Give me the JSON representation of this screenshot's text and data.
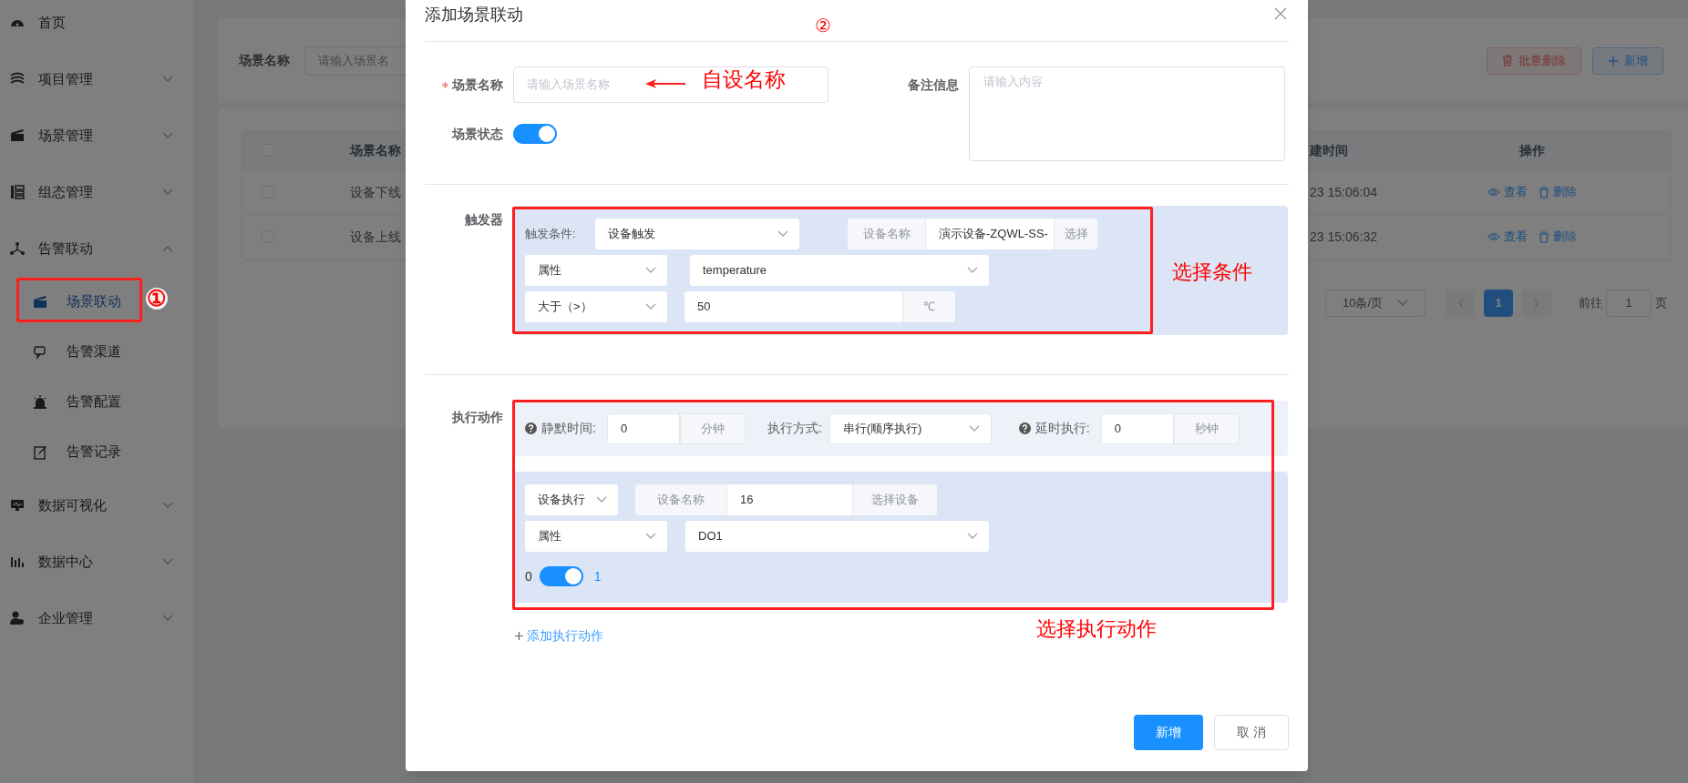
{
  "sidebar": {
    "items": [
      {
        "label": "首页",
        "expandable": false
      },
      {
        "label": "项目管理",
        "expandable": true,
        "expanded": false
      },
      {
        "label": "场景管理",
        "expandable": true,
        "expanded": false
      },
      {
        "label": "组态管理",
        "expandable": true,
        "expanded": false
      },
      {
        "label": "告警联动",
        "expandable": true,
        "expanded": true,
        "children": [
          {
            "label": "场景联动",
            "selected": true
          },
          {
            "label": "告警渠道",
            "selected": false
          },
          {
            "label": "告警配置",
            "selected": false
          },
          {
            "label": "告警记录",
            "selected": false
          }
        ]
      },
      {
        "label": "数据可视化",
        "expandable": true,
        "expanded": false
      },
      {
        "label": "数据中心",
        "expandable": true,
        "expanded": false
      },
      {
        "label": "企业管理",
        "expandable": true,
        "expanded": false
      }
    ]
  },
  "page": {
    "search": {
      "label": "场景名称",
      "placeholder": "请输入场景名"
    },
    "buttons": [
      {
        "label": "批量删除",
        "kind": "danger"
      },
      {
        "label": "新增",
        "kind": "primary"
      }
    ],
    "table": {
      "all_checked": false,
      "columns": [
        "场景名称",
        "建时间",
        "操作"
      ],
      "rows": [
        {
          "name": "设备下线",
          "time": "23 15:06:04",
          "actions": [
            "查看",
            "删除"
          ],
          "checked": false
        },
        {
          "name": "设备上线",
          "time": "23 15:06:32",
          "actions": [
            "查看",
            "删除"
          ],
          "checked": false
        }
      ]
    },
    "pagination": {
      "page_size": "10条/页",
      "pages": [
        {
          "label": "1",
          "selected": true
        }
      ],
      "goto_label": "前往",
      "goto_value": "1",
      "goto_suffix": "页"
    }
  },
  "dialog": {
    "title": "添加场景联动",
    "name": {
      "label": "场景名称",
      "required": true,
      "placeholder": "请输入场景名称"
    },
    "remark": {
      "label": "备注信息",
      "placeholder": "请输入内容"
    },
    "status": {
      "label": "场景状态",
      "on": true
    },
    "trigger": {
      "label": "触发器",
      "condition_label": "触发条件:",
      "condition": "设备触发",
      "device": {
        "prepend": "设备名称",
        "value": "演示设备-ZQWL-SS-",
        "append": "选择"
      },
      "property_type": "属性",
      "property": "temperature",
      "operator": "大于（>）",
      "value": "50",
      "unit": "℃"
    },
    "actions": {
      "label": "执行动作",
      "silence": {
        "label": "静默时间:",
        "value": "0",
        "unit": "分钟"
      },
      "mode": {
        "label": "执行方式:",
        "value": "串行(顺序执行)"
      },
      "delay": {
        "label": "延时执行:",
        "value": "0",
        "unit": "秒钟"
      },
      "items": [
        {
          "type": "设备执行",
          "device": {
            "prepend": "设备名称",
            "value": "16",
            "append": "选择设备"
          },
          "property_type": "属性",
          "property": "DO1",
          "off_label": "0",
          "on_label": "1",
          "on": true
        }
      ],
      "add_link": "添加执行动作"
    },
    "footer": [
      {
        "label": "新增",
        "kind": "primary"
      },
      {
        "label": "取 消",
        "kind": "default"
      }
    ]
  },
  "annotations": [
    {
      "text": "①"
    },
    {
      "text": "②"
    },
    {
      "text": "自设名称"
    },
    {
      "text": "选择条件"
    },
    {
      "text": "选择执行动作"
    }
  ]
}
